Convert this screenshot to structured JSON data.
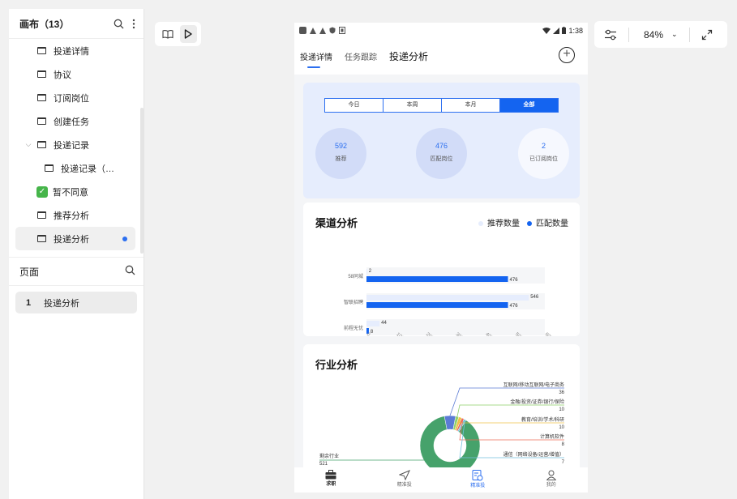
{
  "left_panel": {
    "canvas_title": "画布（13）",
    "layers": [
      {
        "label": "投递详情",
        "type": "frame",
        "indent": 0
      },
      {
        "label": "协议",
        "type": "frame",
        "indent": 0
      },
      {
        "label": "订阅岗位",
        "type": "frame",
        "indent": 0
      },
      {
        "label": "创建任务",
        "type": "frame",
        "indent": 0
      },
      {
        "label": "投递记录",
        "type": "frame",
        "indent": 0,
        "expanded": true
      },
      {
        "label": "投递记录（…",
        "type": "frame",
        "indent": 1
      },
      {
        "label": "暂不同意",
        "type": "check",
        "indent": 0
      },
      {
        "label": "推荐分析",
        "type": "frame",
        "indent": 0
      },
      {
        "label": "投递分析",
        "type": "frame",
        "indent": 0,
        "selected": true
      }
    ],
    "pages_title": "页面",
    "pages": [
      {
        "num": "1",
        "label": "投递分析"
      }
    ]
  },
  "zoom": {
    "level": "84%"
  },
  "phone": {
    "status_time": "1:38",
    "tabs": [
      "投递详情",
      "任务跟踪",
      "投递分析"
    ],
    "segments": [
      "今日",
      "本周",
      "本月",
      "全部"
    ],
    "stats": [
      {
        "value": "592",
        "label": "推荐"
      },
      {
        "value": "476",
        "label": "匹配岗位"
      },
      {
        "value": "2",
        "label": "已订阅岗位"
      }
    ],
    "channel": {
      "title": "渠道分析",
      "legend": [
        "推荐数量",
        "匹配数量"
      ]
    },
    "industry": {
      "title": "行业分析"
    },
    "nav": [
      "求职",
      "精准投",
      "精准投",
      "我的"
    ]
  },
  "colors": {
    "accent": "#1464f0",
    "light": "#e6edfd",
    "pie_main": "#46a26b"
  },
  "chart_data": [
    {
      "type": "bar",
      "title": "渠道分析",
      "categories": [
        "58同城",
        "智联招聘",
        "前程无忧"
      ],
      "series": [
        {
          "name": "推荐数量",
          "values": [
            2,
            546,
            44
          ]
        },
        {
          "name": "匹配数量",
          "values": [
            476,
            476,
            8
          ]
        }
      ],
      "xlim": [
        0,
        600
      ],
      "xticks": [
        "0",
        "100",
        "200",
        "300",
        "400",
        "500",
        "600"
      ],
      "legend": "top-right"
    },
    {
      "type": "pie",
      "title": "行业分析",
      "slices": [
        {
          "label": "互联网/移动互联网/电子商务",
          "value": 36,
          "color": "#5b7bd5"
        },
        {
          "label": "金融/投资/证券/银行/保险",
          "value": 10,
          "color": "#8fd06a"
        },
        {
          "label": "教育/培训/学术/科研",
          "value": 10,
          "color": "#f0c247"
        },
        {
          "label": "计算机软件",
          "value": 8,
          "color": "#ec6c5a"
        },
        {
          "label": "通信（网络设备/运营/增值）",
          "value": 7,
          "color": "#74c0de"
        },
        {
          "label": "剩余行业",
          "value": 521,
          "color": "#46a26b"
        }
      ]
    }
  ]
}
